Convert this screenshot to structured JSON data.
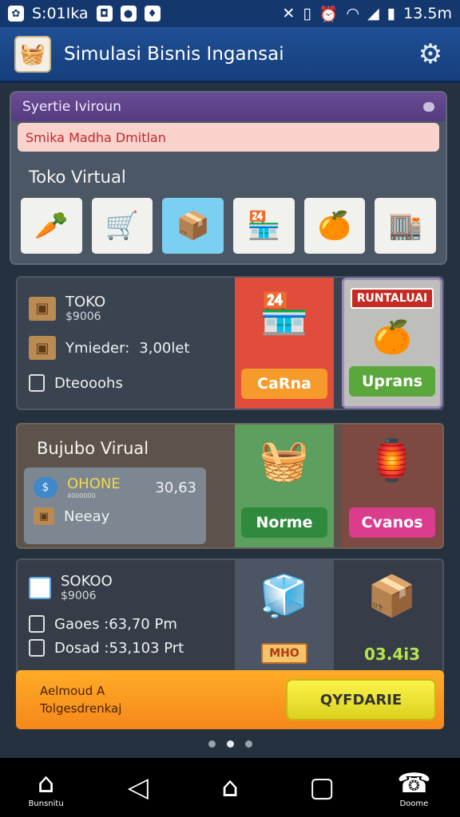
{
  "status_bar": {
    "left_text": "S:01Ika",
    "time": "13.5m",
    "icons": [
      "app-icon",
      "bag-icon",
      "chat-icon",
      "location-icon",
      "mute-icon",
      "vibrate-icon",
      "alarm-icon",
      "wifi-icon",
      "signal-icon",
      "battery-icon"
    ]
  },
  "app_bar": {
    "title": "Simulasi Bisnis Ingansai",
    "settings_icon": "gear-icon"
  },
  "top_panel": {
    "header": "Syertie Iviroun",
    "alert": "Smika Madha Dmitlan",
    "section_title": "Toko Virtual",
    "thumbnails": [
      "vegetables",
      "market-cart",
      "shipping-box",
      "food-shop",
      "fruit-crate",
      "store-front"
    ]
  },
  "row1": {
    "title": "TOKO",
    "code": "$9006",
    "meta_label": "Ymieder:",
    "meta_value": "3,00let",
    "note": "Dteooohs",
    "tile1_button": "CaRna",
    "tile2_tag": "RUNTALUAI",
    "tile2_button": "Uprans"
  },
  "row2": {
    "title": "Bujubo Virual",
    "coin_label": "OHONE",
    "coin_sub": "4000000",
    "coin_value": "30,63",
    "item_label": "Neeay",
    "tile1_button": "Norme",
    "tile2_button": "Cvanos"
  },
  "row3": {
    "title": "SOKOO",
    "code": "$9006",
    "line1": "Gaoes :63,70 Pm",
    "line2": "Dosad :53,103 Prt",
    "tile1_tag": "MHO",
    "tile2_value": "03.4i3"
  },
  "banner": {
    "line1": "Aelmoud A",
    "line2": "Tolgesdrenkaj",
    "button": "QYFDARIE"
  },
  "nav": {
    "home_label": "Bunsnitu",
    "right_label": "Doome"
  }
}
